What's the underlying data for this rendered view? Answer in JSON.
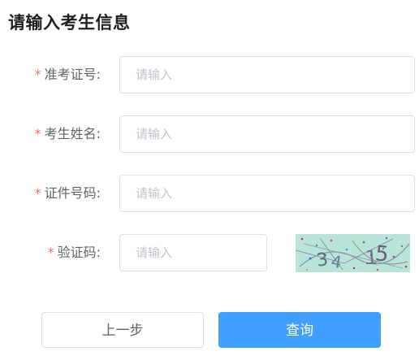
{
  "page": {
    "title": "请输入考生信息"
  },
  "form": {
    "required_mark": "*",
    "fields": [
      {
        "label": "准考证号:",
        "placeholder": "请输入",
        "value": ""
      },
      {
        "label": "考生姓名:",
        "placeholder": "请输入",
        "value": ""
      },
      {
        "label": "证件号码:",
        "placeholder": "请输入",
        "value": ""
      },
      {
        "label": "验证码:",
        "placeholder": "请输入",
        "value": ""
      }
    ]
  },
  "captcha": {
    "background_color": "#b9e4da",
    "characters": [
      "3",
      "4",
      "1",
      "5"
    ]
  },
  "buttons": {
    "prev_label": "上一步",
    "submit_label": "查询"
  },
  "colors": {
    "primary": "#409eff",
    "required": "#f56c6c",
    "border": "#dcdfe6",
    "placeholder": "#c0c4cc"
  }
}
